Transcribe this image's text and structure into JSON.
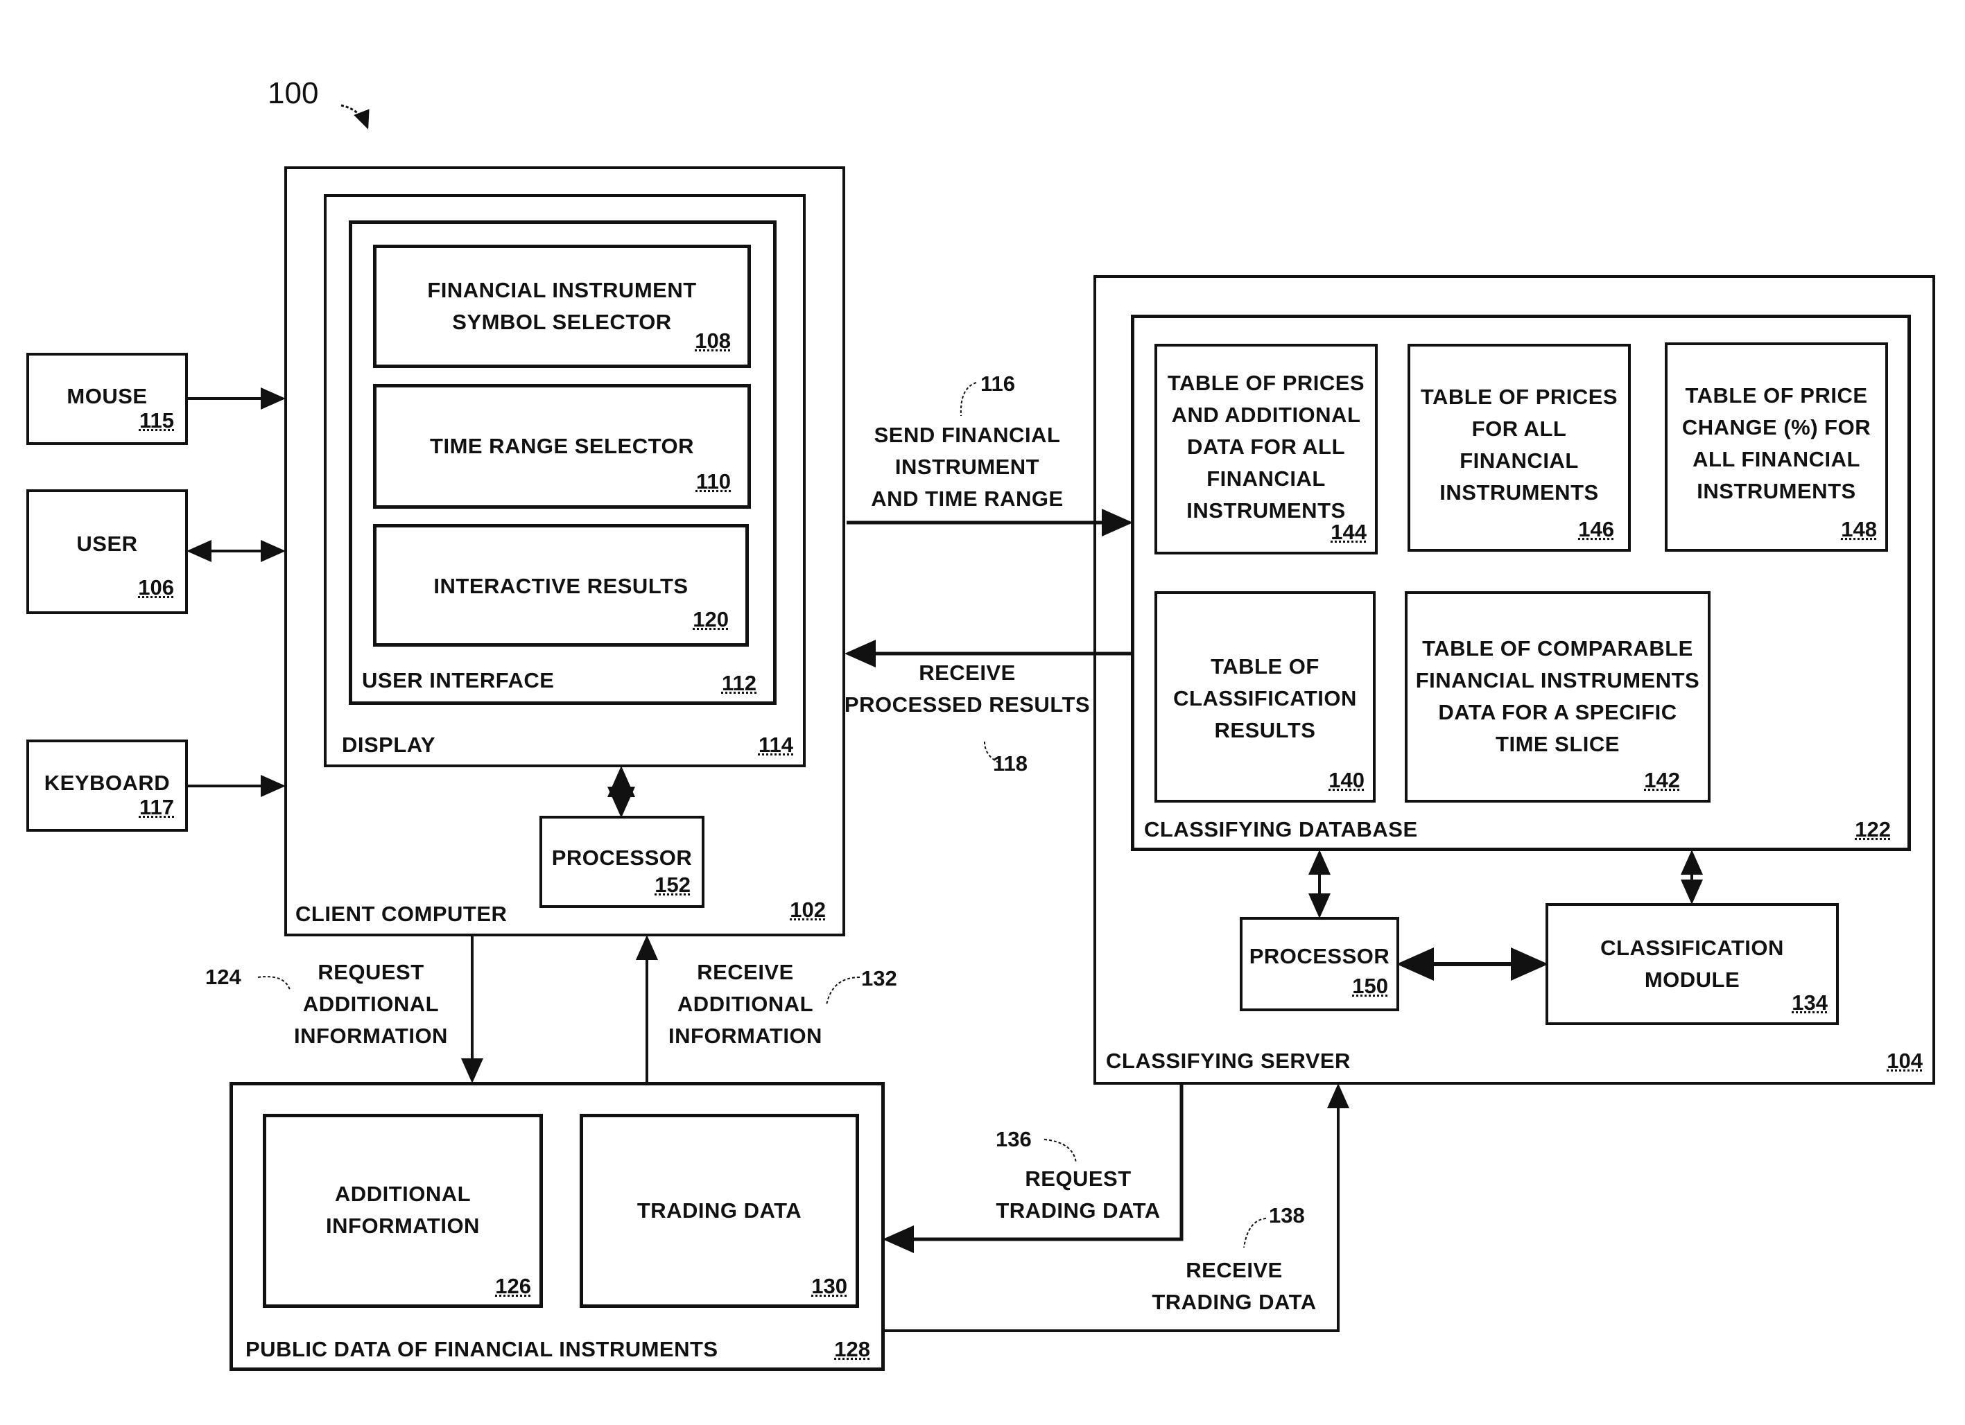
{
  "figure": {
    "number": "100"
  },
  "client_computer": {
    "label": "CLIENT COMPUTER",
    "ref": "102",
    "display": {
      "label": "DISPLAY",
      "ref": "114",
      "user_interface": {
        "label": "USER INTERFACE",
        "ref": "112",
        "components": [
          {
            "label": "FINANCIAL INSTRUMENT SYMBOL SELECTOR",
            "lines": [
              "FINANCIAL INSTRUMENT",
              "SYMBOL SELECTOR"
            ],
            "ref": "108"
          },
          {
            "label": "TIME RANGE SELECTOR",
            "lines": [
              "TIME RANGE SELECTOR"
            ],
            "ref": "110"
          },
          {
            "label": "INTERACTIVE RESULTS",
            "lines": [
              "INTERACTIVE RESULTS"
            ],
            "ref": "120"
          }
        ]
      }
    },
    "processor": {
      "label": "PROCESSOR",
      "ref": "152"
    }
  },
  "inputs": [
    {
      "label": "MOUSE",
      "ref": "115",
      "direction": "to-client"
    },
    {
      "label": "USER",
      "ref": "106",
      "direction": "bidirectional"
    },
    {
      "label": "KEYBOARD",
      "ref": "117",
      "direction": "to-client"
    }
  ],
  "classifying_server": {
    "label": "CLASSIFYING SERVER",
    "ref": "104",
    "database": {
      "label": "CLASSIFYING DATABASE",
      "ref": "122",
      "tables": [
        {
          "lines": [
            "TABLE OF PRICES",
            "AND ADDITIONAL",
            "DATA FOR ALL",
            "FINANCIAL",
            "INSTRUMENTS"
          ],
          "ref": "144"
        },
        {
          "lines": [
            "TABLE OF PRICES",
            "FOR ALL",
            "FINANCIAL",
            "INSTRUMENTS"
          ],
          "ref": "146"
        },
        {
          "lines": [
            "TABLE OF PRICE",
            "CHANGE (%) FOR",
            "ALL FINANCIAL",
            "INSTRUMENTS"
          ],
          "ref": "148"
        },
        {
          "lines": [
            "TABLE OF",
            "CLASSIFICATION",
            "RESULTS"
          ],
          "ref": "140"
        },
        {
          "lines": [
            "TABLE OF COMPARABLE",
            "FINANCIAL INSTRUMENTS",
            "DATA FOR A SPECIFIC",
            "TIME SLICE"
          ],
          "ref": "142"
        }
      ]
    },
    "processor": {
      "label": "PROCESSOR",
      "ref": "150"
    },
    "classification_module": {
      "lines": [
        "CLASSIFICATION",
        "MODULE"
      ],
      "ref": "134"
    }
  },
  "public_data": {
    "label": "PUBLIC DATA OF FINANCIAL INSTRUMENTS",
    "ref": "128",
    "additional_information": {
      "lines": [
        "ADDITIONAL",
        "INFORMATION"
      ],
      "ref": "126"
    },
    "trading_data": {
      "lines": [
        "TRADING DATA"
      ],
      "ref": "130"
    }
  },
  "flows": {
    "send": {
      "lines": [
        "SEND FINANCIAL",
        "INSTRUMENT",
        "AND TIME RANGE"
      ],
      "ref": "116"
    },
    "receive_results": {
      "lines": [
        "RECEIVE",
        "PROCESSED RESULTS"
      ],
      "ref": "118"
    },
    "request_additional": {
      "lines": [
        "REQUEST",
        "ADDITIONAL",
        "INFORMATION"
      ],
      "ref": "124"
    },
    "receive_additional": {
      "lines": [
        "RECEIVE",
        "ADDITIONAL",
        "INFORMATION"
      ],
      "ref": "132"
    },
    "request_trading": {
      "lines": [
        "REQUEST",
        "TRADING DATA"
      ],
      "ref": "136"
    },
    "receive_trading": {
      "lines": [
        "RECEIVE",
        "TRADING DATA"
      ],
      "ref": "138"
    }
  }
}
